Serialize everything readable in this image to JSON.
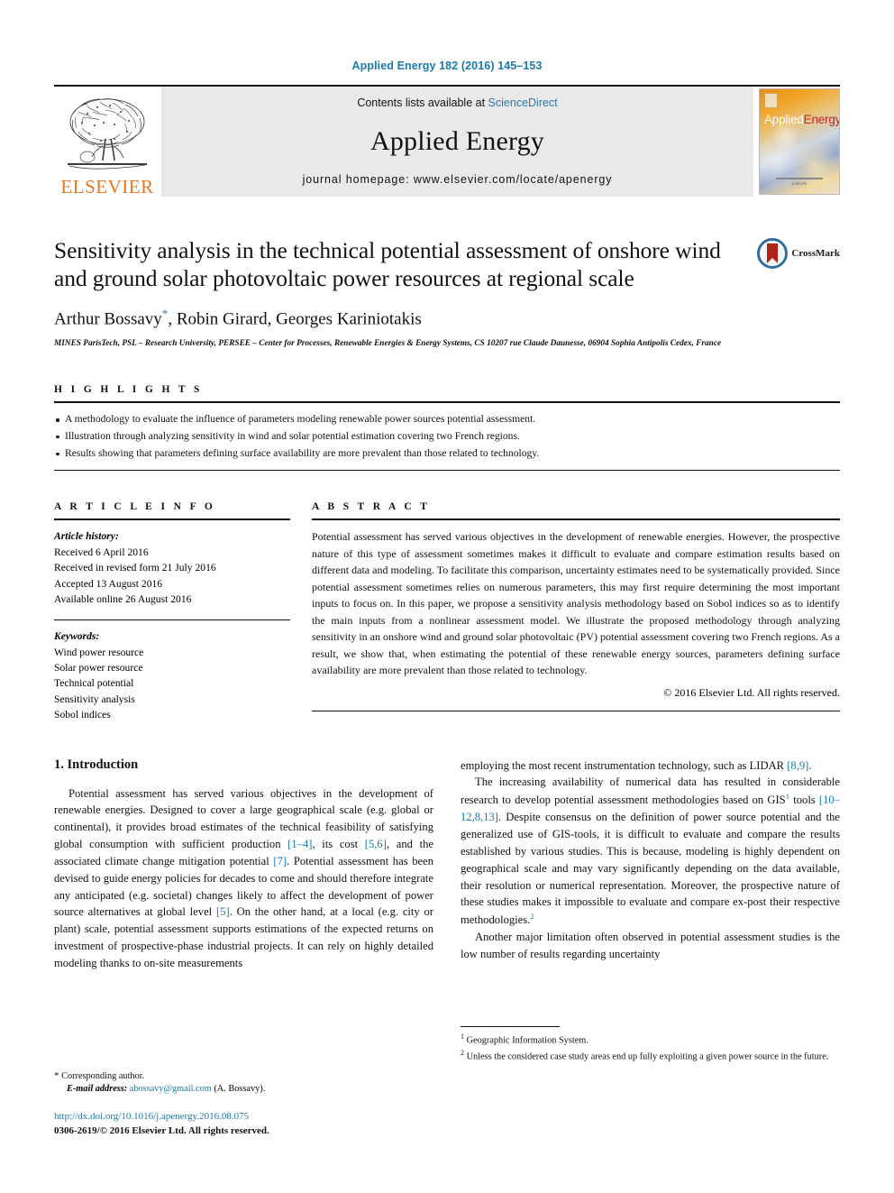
{
  "running_head": "Applied Energy 182 (2016) 145–153",
  "masthead": {
    "publisher_logo_text": "ELSEVIER",
    "contents_prefix": "Contents lists available at",
    "contents_link": "ScienceDirect",
    "journal_name": "Applied Energy",
    "homepage": "journal homepage: www.elsevier.com/locate/apenergy",
    "cover": {
      "title_first": "Applied",
      "title_second": "Energy",
      "footer_text": "www.elsevier.com/locate/apenergy",
      "imprint": "ELSEVIER"
    }
  },
  "article": {
    "title": "Sensitivity analysis in the technical potential assessment of onshore wind and ground solar photovoltaic power resources at regional scale",
    "authors": "Arthur Bossavy",
    "authors_rest": ", Robin Girard, Georges Kariniotakis",
    "corresponding_marker": "*",
    "affiliation": "MINES ParisTech, PSL – Research University, PERSEE – Center for Processes, Renewable Energies & Energy Systems, CS 10207 rue Claude Daunesse, 06904 Sophia Antipolis Cedex, France",
    "crossmark_label": "CrossMark"
  },
  "highlights": {
    "heading": "H I G H L I G H T S",
    "items": [
      "A methodology to evaluate the influence of parameters modeling renewable power sources potential assessment.",
      "Illustration through analyzing sensitivity in wind and solar potential estimation covering two French regions.",
      "Results showing that parameters defining surface availability are more prevalent than those related to technology."
    ]
  },
  "article_info": {
    "heading": "A R T I C L E    I N F O",
    "history_label": "Article history:",
    "history": [
      "Received 6 April 2016",
      "Received in revised form 21 July 2016",
      "Accepted 13 August 2016",
      "Available online 26 August 2016"
    ],
    "keywords_label": "Keywords:",
    "keywords": [
      "Wind power resource",
      "Solar power resource",
      "Technical potential",
      "Sensitivity analysis",
      "Sobol indices"
    ]
  },
  "abstract": {
    "heading": "A B S T R A C T",
    "text": "Potential assessment has served various objectives in the development of renewable energies. However, the prospective nature of this type of assessment sometimes makes it difficult to evaluate and compare estimation results based on different data and modeling. To facilitate this comparison, uncertainty estimates need to be systematically provided. Since potential assessment sometimes relies on numerous parameters, this may first require determining the most important inputs to focus on. In this paper, we propose a sensitivity analysis methodology based on Sobol indices so as to identify the main inputs from a nonlinear assessment model. We illustrate the proposed methodology through analyzing sensitivity in an onshore wind and ground solar photovoltaic (PV) potential assessment covering two French regions. As a result, we show that, when estimating the potential of these renewable energy sources, parameters defining surface availability are more prevalent than those related to technology.",
    "copyright": "© 2016 Elsevier Ltd. All rights reserved."
  },
  "body": {
    "section_number_title": "1. Introduction",
    "left_para1_a": "Potential assessment has served various objectives in the development of renewable energies. Designed to cover a large geographical scale (e.g. global or continental), it provides broad estimates of the technical feasibility of satisfying global consumption with sufficient production ",
    "left_ref1": "[1–4]",
    "left_para1_b": ", its cost ",
    "left_ref2": "[5,6]",
    "left_para1_c": ", and the associated climate change mitigation potential ",
    "left_ref3": "[7]",
    "left_para1_d": ". Potential assessment has been devised to guide energy policies for decades to come and should therefore integrate any anticipated (e.g. societal) changes likely to affect the development of power source alternatives at global level ",
    "left_ref4": "[5]",
    "left_para1_e": ". On the other hand, at a local (e.g. city or plant) scale, potential assessment supports estimations of the expected returns on investment of prospective-phase industrial projects. It can rely on highly detailed modeling thanks to on-site measurements",
    "right_para0_a": "employing the most recent instrumentation technology, such as LIDAR ",
    "right_ref0": "[8,9]",
    "right_para0_b": ".",
    "right_para1_a": "The increasing availability of numerical data has resulted in considerable research to develop potential assessment methodologies based on GIS",
    "right_sup1": "1",
    "right_para1_b": " tools ",
    "right_ref1": "[10–12,8,13]",
    "right_para1_c": ". Despite consensus on the definition of power source potential and the generalized use of GIS-tools, it is difficult to evaluate and compare the results established by various studies. This is because, modeling is highly dependent on geographical scale and may vary significantly depending on the data available, their resolution or numerical representation. Moreover, the prospective nature of these studies makes it impossible to evaluate and compare ex-post their respective methodologies.",
    "right_sup2": "2",
    "right_para2": "Another major limitation often observed in potential assessment studies is the low number of results regarding uncertainty"
  },
  "footnotes": [
    {
      "marker": "1",
      "text": "Geographic Information System."
    },
    {
      "marker": "2",
      "text": "Unless the considered case study areas end up fully exploiting a given power source in the future."
    }
  ],
  "page_footer": {
    "corresponding_marker": "*",
    "corresponding_text": "Corresponding author.",
    "email_label": "E-mail address:",
    "email": "abossavy@gmail.com",
    "email_suffix": "(A. Bossavy).",
    "doi": "http://dx.doi.org/10.1016/j.apenergy.2016.08.075",
    "issn_line": "0306-2619/© 2016 Elsevier Ltd. All rights reserved."
  },
  "colors": {
    "link_blue": "#1a7aaa",
    "sciencedirect_blue": "#2a7ab0",
    "elsevier_orange": "#e87722",
    "crossmark_red": "#b02418"
  }
}
